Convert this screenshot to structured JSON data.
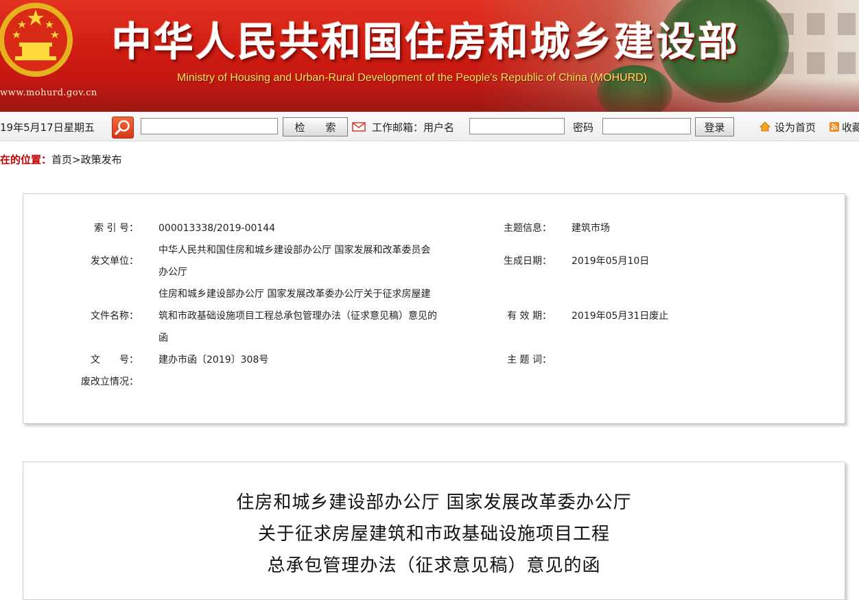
{
  "banner": {
    "title": "中华人民共和国住房和城乡建设部",
    "subtitle": "Ministry of Housing and Urban-Rural Development of the People's Republic of China (MOHURD)",
    "url": "www.mohurd.gov.cn"
  },
  "toolbar": {
    "date": "19年5月17日",
    "weekday": "星期五",
    "search_button": "检　　索",
    "mail_label": "工作邮箱：用户名",
    "password_label": "密码",
    "login_button": "登录",
    "set_home": "设为首页",
    "bookmark": "收藏"
  },
  "breadcrumb": {
    "label": "在的位置：",
    "home": "首页",
    "sep": ">",
    "current": "政策发布"
  },
  "info": {
    "index_label": "索 引 号：",
    "index_value": "000013338/2019-00144",
    "topic_label": "主题信息：",
    "topic_value": "建筑市场",
    "issuer_label": "发文单位：",
    "issuer_value": "中华人民共和国住房和城乡建设部办公厅 国家发展和改革委员会办公厅",
    "date_label": "生成日期：",
    "date_value": "2019年05月10日",
    "name_label": "文件名称：",
    "name_value": "住房和城乡建设部办公厅 国家发展改革委办公厅关于征求房屋建筑和市政基础设施项目工程总承包管理办法（征求意见稿）意见的函",
    "validity_label": "有 效 期：",
    "validity_value": "2019年05月31日废止",
    "docno_label": "文　　号：",
    "docno_value": "建办市函〔2019〕308号",
    "keywords_label": "主 题 词：",
    "keywords_value": "",
    "status_label": "废改立情况：",
    "status_value": ""
  },
  "document": {
    "title_line1": "住房和城乡建设部办公厅  国家发展改革委办公厅",
    "title_line2": "关于征求房屋建筑和市政基础设施项目工程",
    "title_line3": "总承包管理办法（征求意见稿）意见的函"
  },
  "colors": {
    "banner_red": "#d01c12",
    "breadcrumb_label": "#c00000",
    "subtitle_yellow": "#ffe65c"
  }
}
